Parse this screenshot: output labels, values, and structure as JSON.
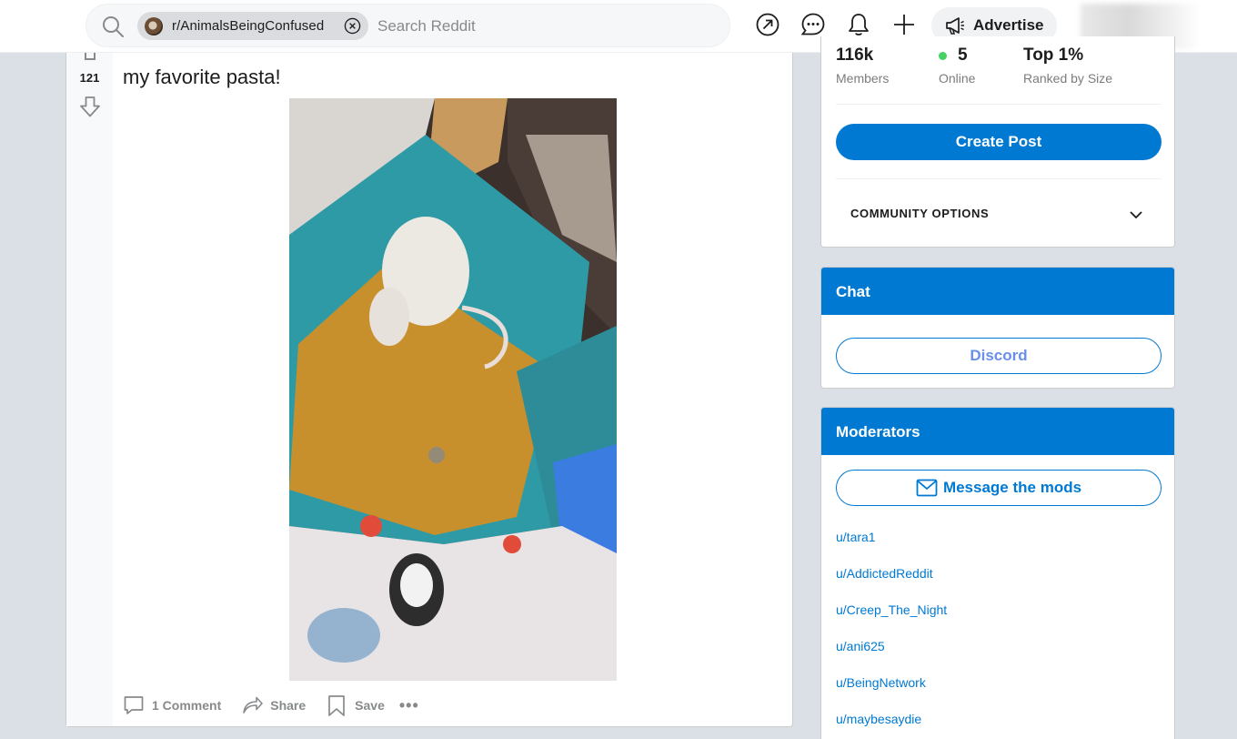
{
  "header": {
    "search_chip": "r/AnimalsBeingConfused",
    "search_placeholder": "Search Reddit",
    "advertise_label": "Advertise",
    "icons": [
      "search-icon",
      "popular-icon",
      "chat-icon",
      "notification-bell-icon",
      "plus-icon",
      "megaphone-icon"
    ]
  },
  "post": {
    "score": "121",
    "title": "my favorite pasta!",
    "actions": {
      "comments": "1 Comment",
      "share": "Share",
      "save": "Save",
      "more": "•••"
    }
  },
  "sidebar": {
    "about": {
      "members_value": "116k",
      "members_label": "Members",
      "online_value": "5",
      "online_label": "Online",
      "rank_value": "Top 1%",
      "rank_label": "Ranked by Size",
      "create_post": "Create Post",
      "community_options": "COMMUNITY OPTIONS"
    },
    "chat": {
      "title": "Chat",
      "discord": "Discord"
    },
    "moderators": {
      "title": "Moderators",
      "message_button": "Message the mods",
      "list": [
        "u/tara1",
        "u/AddictedReddit",
        "u/Creep_The_Night",
        "u/ani625",
        "u/BeingNetwork",
        "u/maybesaydie"
      ]
    }
  },
  "colors": {
    "brand_blue": "#0079d3",
    "online_green": "#46d160",
    "page_bg": "#dae0e6"
  }
}
